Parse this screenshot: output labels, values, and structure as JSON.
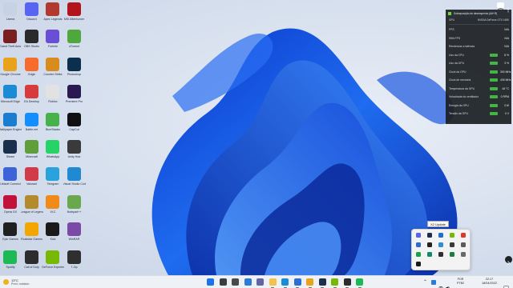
{
  "desktop_icons": [
    {
      "label": "Lixeira",
      "color": "#c7d3e2"
    },
    {
      "label": "Grand Theft Auto V",
      "color": "#7a1f1f"
    },
    {
      "label": "Google Chrome",
      "color": "#e8a21b"
    },
    {
      "label": "Microsoft Edge",
      "color": "#1b8bd6"
    },
    {
      "label": "Wallpaper Engine",
      "color": "#1a7dcf"
    },
    {
      "label": "Steam",
      "color": "#1a2f4b"
    },
    {
      "label": "Ubisoft Connect",
      "color": "#3c63d8"
    },
    {
      "label": "Opera GX",
      "color": "#c3123a"
    },
    {
      "label": "Epic Games",
      "color": "#202020"
    },
    {
      "label": "Spotify",
      "color": "#1db954"
    },
    {
      "label": "Discord",
      "color": "#5865f2"
    },
    {
      "label": "OBS Studio",
      "color": "#2a2a2a"
    },
    {
      "label": "Origin",
      "color": "#f56c2d"
    },
    {
      "label": "EA Desktop",
      "color": "#d83b3b"
    },
    {
      "label": "Battle.net",
      "color": "#148eff"
    },
    {
      "label": "Minecraft",
      "color": "#5f9e3a"
    },
    {
      "label": "Valorant",
      "color": "#d13b47"
    },
    {
      "label": "League of Legends",
      "color": "#b38b2d"
    },
    {
      "label": "Rockstar Games",
      "color": "#f4a600"
    },
    {
      "label": "Call of Duty",
      "color": "#2d2d2d"
    },
    {
      "label": "Apex Legends",
      "color": "#b2392f"
    },
    {
      "label": "Fortnite",
      "color": "#6a4ed6"
    },
    {
      "label": "Counter-Strike",
      "color": "#d88c1e"
    },
    {
      "label": "Roblox",
      "color": "#e2e2e2"
    },
    {
      "label": "BlueStacks",
      "color": "#47b14a"
    },
    {
      "label": "WhatsApp",
      "color": "#25d366"
    },
    {
      "label": "Telegram",
      "color": "#2aa3dd"
    },
    {
      "label": "VLC",
      "color": "#f08b1a"
    },
    {
      "label": "Kick",
      "color": "#1a1a1a"
    },
    {
      "label": "GeForce Experience",
      "color": "#76b900"
    },
    {
      "label": "MSI Afterburner",
      "color": "#b3141b"
    },
    {
      "label": "uTorrent",
      "color": "#4fa83d"
    },
    {
      "label": "Photoshop",
      "color": "#0b2f4d"
    },
    {
      "label": "Premiere Pro",
      "color": "#2a1a4f"
    },
    {
      "label": "CapCut",
      "color": "#111111"
    },
    {
      "label": "Unity Hub",
      "color": "#3a3a3a"
    },
    {
      "label": "Visual Studio Code",
      "color": "#1f8ad2"
    },
    {
      "label": "Notepad++",
      "color": "#6aa84f"
    },
    {
      "label": "WinRAR",
      "color": "#7a4aa6"
    },
    {
      "label": "7-Zip",
      "color": "#2f2f2f"
    }
  ],
  "perf_overlay": {
    "title": "Sobreposição de desempenho (Alt+R)",
    "gpu_label": "GPU",
    "gpu_name": "NVIDIA GeForce GTX 1650",
    "rows": [
      {
        "label": "FPS",
        "value": "N/A"
      },
      {
        "label": "99th FPS",
        "value": "N/A"
      },
      {
        "label": "Renderizar a latência",
        "value": "N/A"
      },
      {
        "label": "Uso da CPU",
        "value": "8 %"
      },
      {
        "label": "Uso da GPU",
        "value": "3 %"
      },
      {
        "label": "Clock da GPU",
        "value": "300 MHz"
      },
      {
        "label": "Clock de memória",
        "value": "405 MHz"
      },
      {
        "label": "Temperatura da GPU",
        "value": "46 °C"
      },
      {
        "label": "Velocidade do ventilador",
        "value": "0 RPM"
      },
      {
        "label": "Energia da GPU",
        "value": "3 W"
      },
      {
        "label": "Tensão da GPU",
        "value": "0 V"
      }
    ]
  },
  "tooltip": "X2 Update",
  "weather": {
    "temp": "13°C",
    "desc": "Pred. nublado"
  },
  "taskbar_apps": [
    {
      "name": "start-icon",
      "color": "#1a73e8"
    },
    {
      "name": "search-icon",
      "color": "#3c3c3c"
    },
    {
      "name": "task-view-icon",
      "color": "#4a4a4a"
    },
    {
      "name": "widgets-icon",
      "color": "#2f7ad6"
    },
    {
      "name": "chat-icon",
      "color": "#6264a7"
    },
    {
      "name": "file-explorer-icon",
      "color": "#f2c14e"
    },
    {
      "name": "edge-icon",
      "color": "#1b8bd6"
    },
    {
      "name": "store-icon",
      "color": "#2a6fd1"
    },
    {
      "name": "chrome-icon",
      "color": "#e8a21b"
    },
    {
      "name": "steam-icon",
      "color": "#1a2f4b"
    },
    {
      "name": "nvidia-icon",
      "color": "#76b900"
    },
    {
      "name": "terminal-icon",
      "color": "#2b2b2b"
    },
    {
      "name": "spotify-icon",
      "color": "#1db954"
    }
  ],
  "tray_popup_icons": [
    {
      "name": "discord-icon",
      "color": "#5865f2"
    },
    {
      "name": "steam-tray-icon",
      "color": "#1a2f4b"
    },
    {
      "name": "bluetooth-icon",
      "color": "#1f6fd1"
    },
    {
      "name": "nvidia-tray-icon",
      "color": "#76b900"
    },
    {
      "name": "record-icon",
      "color": "#e0362c"
    },
    {
      "name": "security-icon",
      "color": "#2d6ad6"
    },
    {
      "name": "epic-tray-icon",
      "color": "#222222"
    },
    {
      "name": "network-tray-icon",
      "color": "#2b8fd8"
    },
    {
      "name": "driver-tray-icon",
      "color": "#3a3a3a"
    },
    {
      "name": "update-tray-icon",
      "color": "#5c5c5c"
    },
    {
      "name": "app-tray-icon-1",
      "color": "#17a34a"
    },
    {
      "name": "app-tray-icon-2",
      "color": "#0f8a6b"
    },
    {
      "name": "app-tray-icon-3",
      "color": "#2f2f2f"
    },
    {
      "name": "app-tray-icon-4",
      "color": "#1e7f3a"
    },
    {
      "name": "app-tray-icon-5",
      "color": "#6a6a6a"
    },
    {
      "name": "app-tray-icon-6",
      "color": "#1a1a1a"
    }
  ],
  "language": {
    "code": "POR",
    "layout": "PTB2"
  },
  "clock": {
    "time": "22:17",
    "date": "18/04/2022"
  }
}
